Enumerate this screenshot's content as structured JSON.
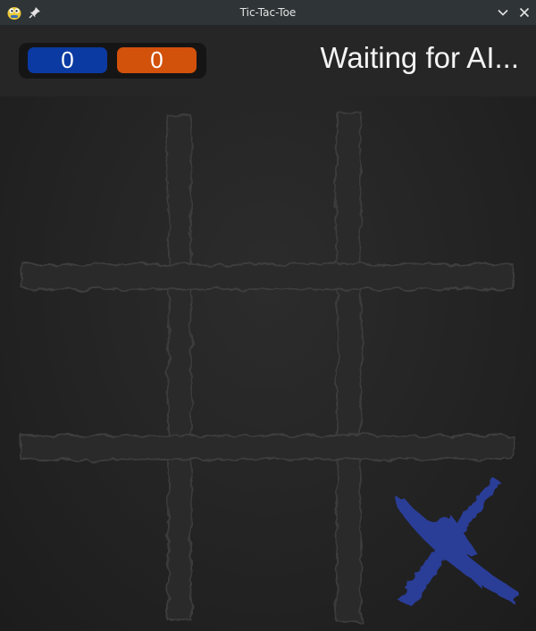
{
  "window": {
    "title": "Tic-Tac-Toe",
    "icons": [
      "python-icon",
      "pin-icon",
      "minimize-chevron-icon",
      "close-icon"
    ]
  },
  "scores": {
    "player_x": "0",
    "player_o": "0",
    "player_x_color": "#0b3aa2",
    "player_o_color": "#d2510b"
  },
  "status": "Waiting for AI...",
  "board": {
    "cells": [
      "",
      "",
      "",
      "",
      "",
      "",
      "",
      "",
      "X"
    ],
    "x_color": "#2b3d97"
  }
}
